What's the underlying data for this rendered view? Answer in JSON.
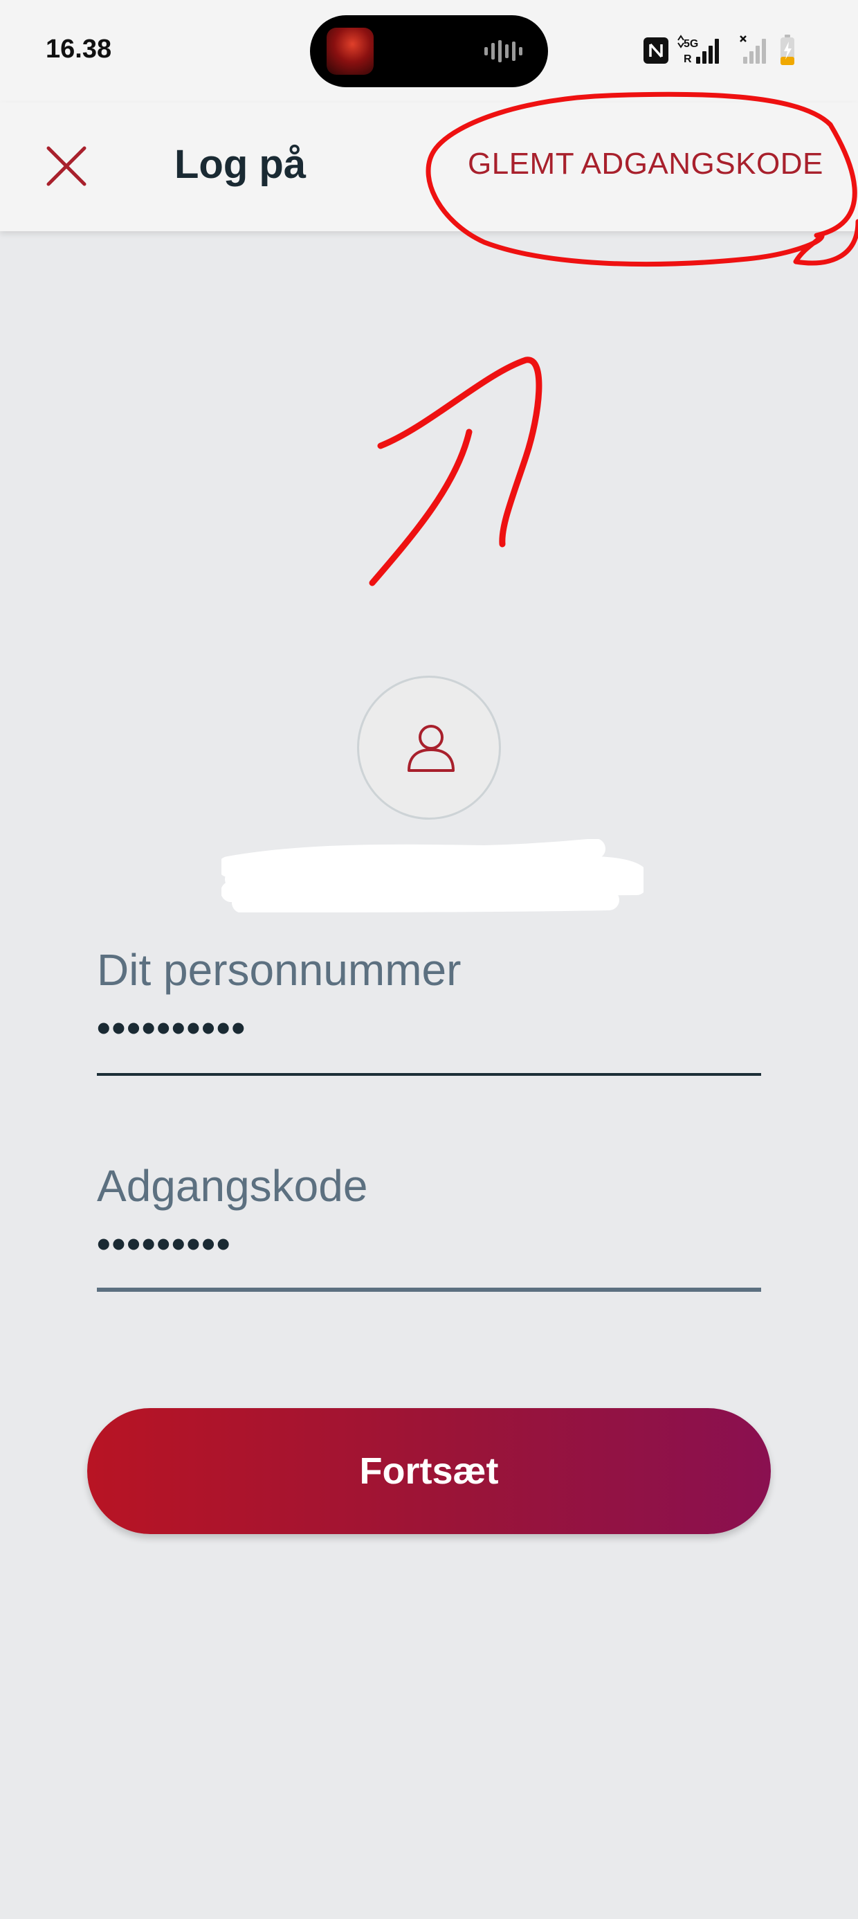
{
  "status_bar": {
    "time": "16.38",
    "network_label": "5G",
    "roaming_label": "R"
  },
  "header": {
    "title": "Log på",
    "forgot_password_label": "GLEMT ADGANGSKODE",
    "close_icon": "close-icon"
  },
  "form": {
    "cpr_label": "Dit personnummer",
    "cpr_value": "••••••••••",
    "password_label": "Adgangskode",
    "password_value": "•••••••••",
    "submit_label": "Fortsæt"
  },
  "colors": {
    "accent": "#a8202c",
    "button_start": "#b81424",
    "button_end": "#8a1050",
    "annotation": "#ee1111",
    "background": "#e9eaec"
  }
}
